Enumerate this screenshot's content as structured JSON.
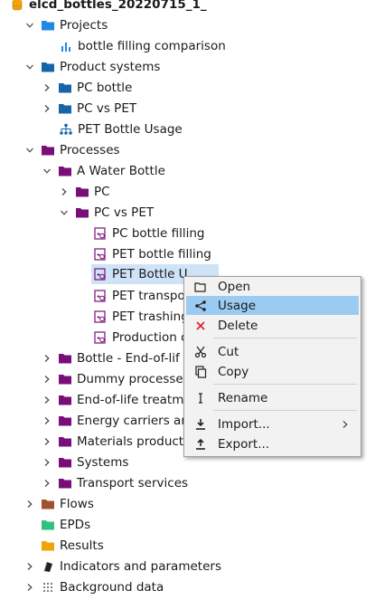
{
  "tree": {
    "root": "elcd_bottles_20220715_1_",
    "projects": "Projects",
    "bottle_filling_comparison": "bottle filling comparison",
    "product_systems": "Product systems",
    "pc_bottle": "PC bottle",
    "pc_vs_pet_ps": "PC vs PET",
    "pet_bottle_usage": "PET Bottle Usage",
    "processes": "Processes",
    "a_water_bottle": "A Water Bottle",
    "pc": "PC",
    "pc_vs_pet": "PC vs PET",
    "pc_bottle_filling": "PC bottle filling",
    "pet_bottle_filling": "PET bottle filling",
    "pet_bottle_u": "PET Bottle U",
    "pet_transpo": "PET transpo",
    "pet_trashing": "PET trashing",
    "production": "Production c",
    "bottle_end_of_life": "Bottle - End-of-lif",
    "dummy_processes": "Dummy processes",
    "end_of_life_treatm": "End-of-life treatm",
    "energy_carriers": "Energy carriers and",
    "materials_product": "Materials product",
    "systems": "Systems",
    "transport_services": "Transport services",
    "flows": "Flows",
    "epds": "EPDs",
    "results": "Results",
    "indicators": "Indicators and parameters",
    "background_data": "Background data"
  },
  "context_menu": {
    "open": "Open",
    "usage": "Usage",
    "delete": "Delete",
    "cut": "Cut",
    "copy": "Copy",
    "rename": "Rename",
    "import": "Import...",
    "export": "Export..."
  },
  "colors": {
    "folder_blue": "#1565a8",
    "folder_purple": "#7a0e78",
    "folder_brown": "#a0522d",
    "epd_green": "#2ec27e",
    "results_orange": "#f0a30a",
    "selection": "#cfe3f7",
    "menu_highlight": "#9ccbf2"
  }
}
